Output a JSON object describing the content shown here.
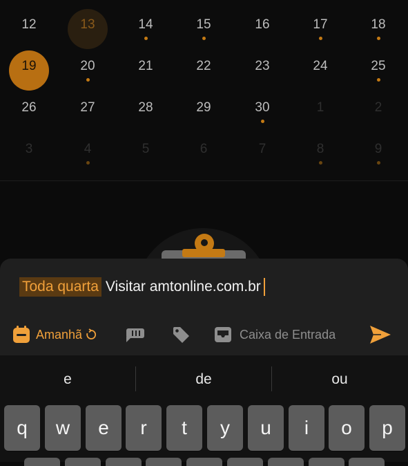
{
  "calendar": {
    "rows": [
      [
        {
          "day": "12",
          "dot": "none",
          "style": "normal"
        },
        {
          "day": "13",
          "dot": "none",
          "style": "today-dim"
        },
        {
          "day": "14",
          "dot": "dot",
          "style": "normal"
        },
        {
          "day": "15",
          "dot": "dot",
          "style": "normal"
        },
        {
          "day": "16",
          "dot": "none",
          "style": "normal"
        },
        {
          "day": "17",
          "dot": "dot",
          "style": "normal"
        },
        {
          "day": "18",
          "dot": "dot",
          "style": "normal"
        }
      ],
      [
        {
          "day": "19",
          "dot": "none",
          "style": "selected"
        },
        {
          "day": "20",
          "dot": "dot",
          "style": "normal"
        },
        {
          "day": "21",
          "dot": "none",
          "style": "normal"
        },
        {
          "day": "22",
          "dot": "none",
          "style": "normal"
        },
        {
          "day": "23",
          "dot": "none",
          "style": "normal"
        },
        {
          "day": "24",
          "dot": "none",
          "style": "normal"
        },
        {
          "day": "25",
          "dot": "dot",
          "style": "normal"
        }
      ],
      [
        {
          "day": "26",
          "dot": "none",
          "style": "normal"
        },
        {
          "day": "27",
          "dot": "none",
          "style": "normal"
        },
        {
          "day": "28",
          "dot": "none",
          "style": "normal"
        },
        {
          "day": "29",
          "dot": "none",
          "style": "normal"
        },
        {
          "day": "30",
          "dot": "dot",
          "style": "normal"
        },
        {
          "day": "1",
          "dot": "none",
          "style": "other-month"
        },
        {
          "day": "2",
          "dot": "none",
          "style": "other-month"
        }
      ],
      [
        {
          "day": "3",
          "dot": "none",
          "style": "other-month"
        },
        {
          "day": "4",
          "dot": "dim",
          "style": "other-month"
        },
        {
          "day": "5",
          "dot": "none",
          "style": "other-month"
        },
        {
          "day": "6",
          "dot": "none",
          "style": "other-month"
        },
        {
          "day": "7",
          "dot": "none",
          "style": "other-month"
        },
        {
          "day": "8",
          "dot": "dim",
          "style": "other-month"
        },
        {
          "day": "9",
          "dot": "dim",
          "style": "other-month"
        }
      ]
    ]
  },
  "task_input": {
    "recurrence_tag": "Toda quarta",
    "text": "Visitar amtonline.com.br"
  },
  "toolbar": {
    "due_label": "Amanhã",
    "due_icon": "calendar-icon",
    "repeat_icon": "repeat-icon",
    "priority_icon": "priority-flag-icon",
    "tag_icon": "tag-icon",
    "project_icon": "inbox-icon",
    "project_label": "Caixa de Entrada",
    "send_icon": "send-icon"
  },
  "keyboard": {
    "suggestions": [
      "e",
      "de",
      "ou"
    ],
    "keys": [
      "q",
      "w",
      "e",
      "r",
      "t",
      "y",
      "u",
      "i",
      "o",
      "p"
    ]
  },
  "colors": {
    "accent": "#f0a03a",
    "accent_dark": "#c47a14",
    "sheet_bg": "#1f1f1f",
    "key_bg": "#5c5c5c"
  }
}
